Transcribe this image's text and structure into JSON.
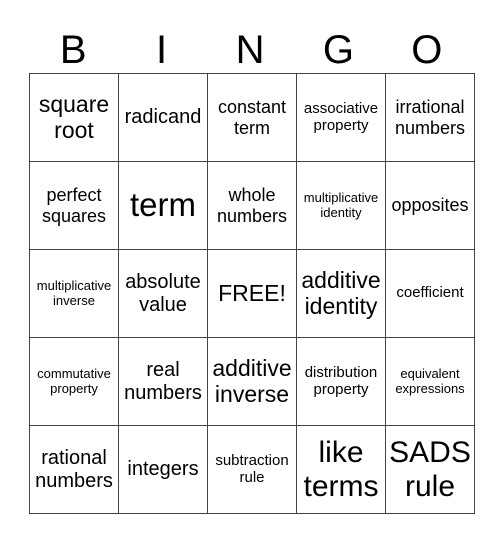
{
  "header": [
    "B",
    "I",
    "N",
    "G",
    "O"
  ],
  "cells": [
    [
      "square root",
      "radicand",
      "constant term",
      "associative property",
      "irrational numbers"
    ],
    [
      "perfect squares",
      "term",
      "whole numbers",
      "multiplicative identity",
      "opposites"
    ],
    [
      "multiplicative inverse",
      "absolute value",
      "FREE!",
      "additive identity",
      "coefficient"
    ],
    [
      "commutative property",
      "real numbers",
      "additive inverse",
      "distribution property",
      "equivalent expressions"
    ],
    [
      "rational numbers",
      "integers",
      "subtraction rule",
      "like terms",
      "SADS rule"
    ]
  ]
}
